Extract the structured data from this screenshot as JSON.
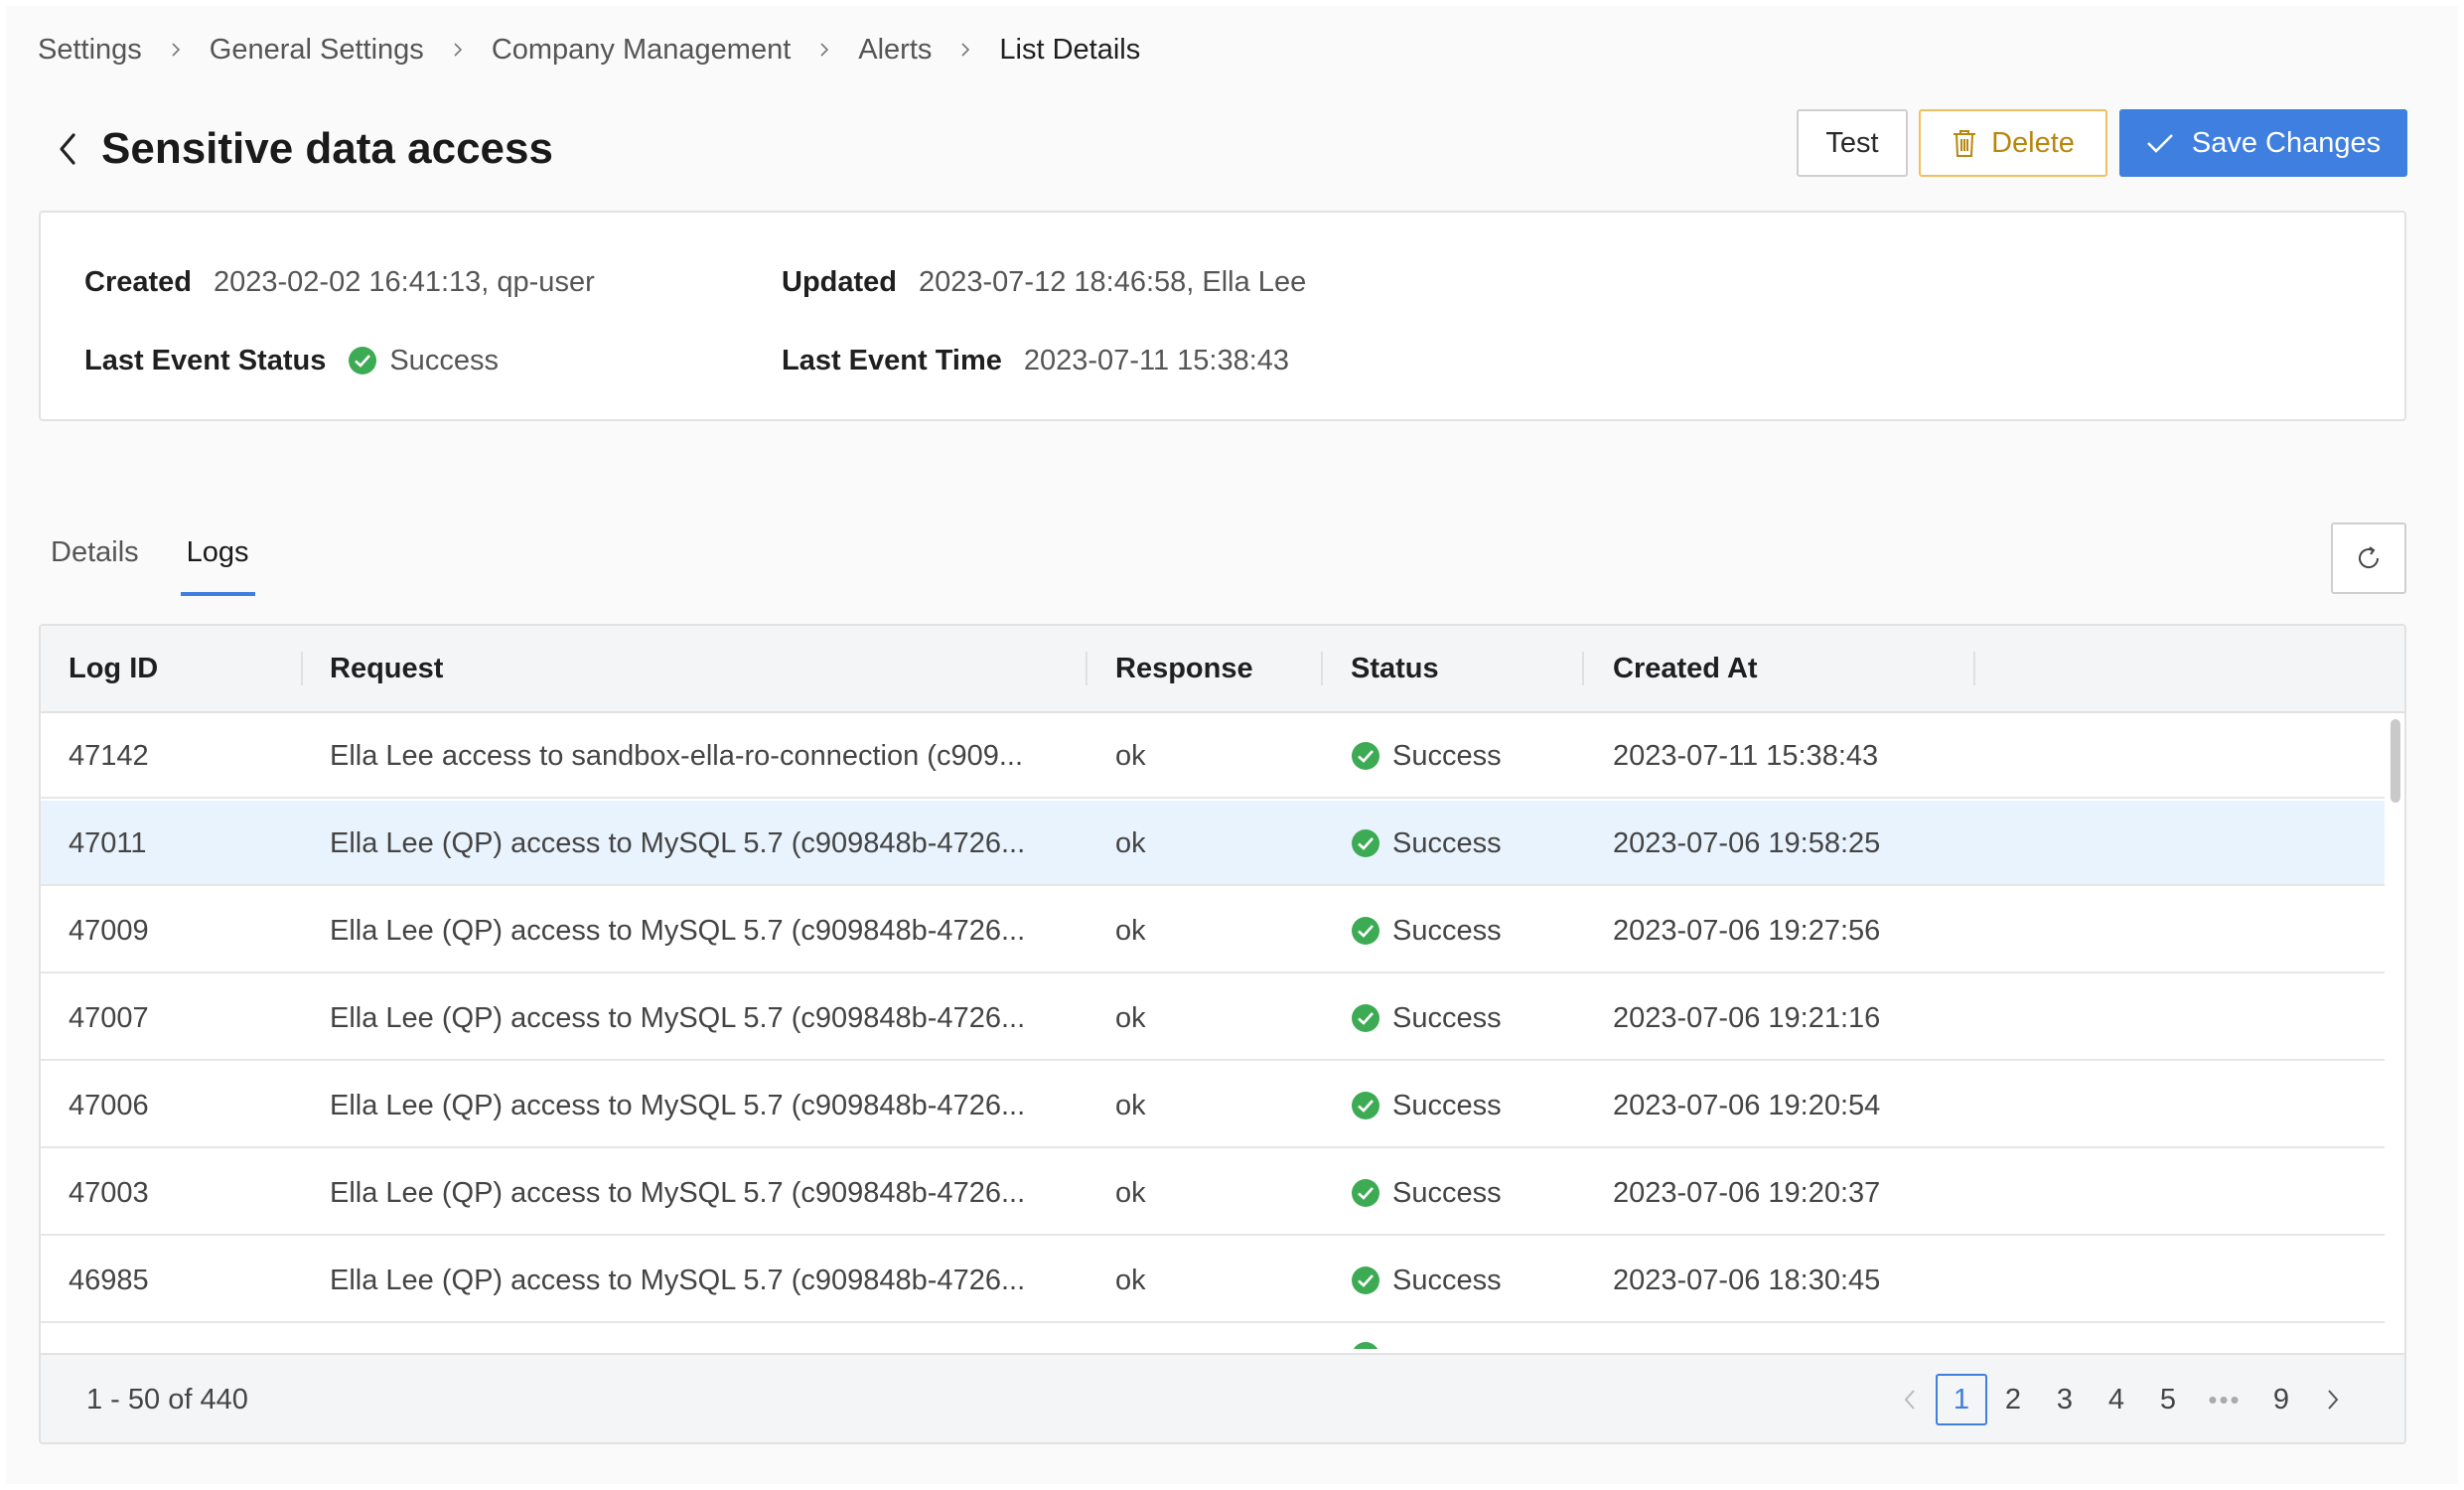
{
  "breadcrumb": [
    "Settings",
    "General Settings",
    "Company Management",
    "Alerts",
    "List Details"
  ],
  "title": "Sensitive data access",
  "actions": {
    "test": "Test",
    "delete": "Delete",
    "save": "Save Changes"
  },
  "info": {
    "created_label": "Created",
    "created_value": "2023-02-02 16:41:13, qp-user",
    "updated_label": "Updated",
    "updated_value": "2023-07-12 18:46:58, Ella Lee",
    "last_status_label": "Last Event Status",
    "last_status_value": "Success",
    "last_time_label": "Last Event Time",
    "last_time_value": "2023-07-11 15:38:43"
  },
  "tabs": [
    "Details",
    "Logs"
  ],
  "active_tab": "Logs",
  "table": {
    "columns": [
      "Log ID",
      "Request",
      "Response",
      "Status",
      "Created At"
    ],
    "rows": [
      {
        "id": "47142",
        "request": "Ella Lee access to sandbox-ella-ro-connection (c909...",
        "response": "ok",
        "status": "Success",
        "created": "2023-07-11 15:38:43"
      },
      {
        "id": "47011",
        "request": "Ella Lee (QP) access to MySQL 5.7 (c909848b-4726...",
        "response": "ok",
        "status": "Success",
        "created": "2023-07-06 19:58:25"
      },
      {
        "id": "47009",
        "request": "Ella Lee (QP) access to MySQL 5.7 (c909848b-4726...",
        "response": "ok",
        "status": "Success",
        "created": "2023-07-06 19:27:56"
      },
      {
        "id": "47007",
        "request": "Ella Lee (QP) access to MySQL 5.7 (c909848b-4726...",
        "response": "ok",
        "status": "Success",
        "created": "2023-07-06 19:21:16"
      },
      {
        "id": "47006",
        "request": "Ella Lee (QP) access to MySQL 5.7 (c909848b-4726...",
        "response": "ok",
        "status": "Success",
        "created": "2023-07-06 19:20:54"
      },
      {
        "id": "47003",
        "request": "Ella Lee (QP) access to MySQL 5.7 (c909848b-4726...",
        "response": "ok",
        "status": "Success",
        "created": "2023-07-06 19:20:37"
      },
      {
        "id": "46985",
        "request": "Ella Lee (QP) access to MySQL 5.7 (c909848b-4726...",
        "response": "ok",
        "status": "Success",
        "created": "2023-07-06 18:30:45"
      }
    ]
  },
  "footer": {
    "range": "1 - 50 of 440",
    "pages": [
      "1",
      "2",
      "3",
      "4",
      "5",
      "•••",
      "9"
    ],
    "current_page": "1"
  },
  "colors": {
    "primary": "#3e7fe0",
    "success": "#3dab54",
    "warning": "#f0c060",
    "selected_row": "#e8f3fd"
  },
  "icons": {
    "back": "chevron-left-icon",
    "delete": "trash-icon",
    "save": "check-icon",
    "refresh": "refresh-icon",
    "status": "check-circle-icon"
  }
}
